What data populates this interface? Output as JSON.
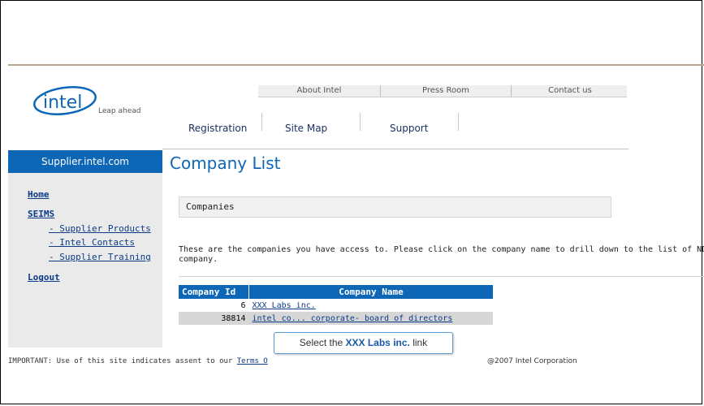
{
  "top_links": [
    "About Intel",
    "Press Room",
    "Contact us"
  ],
  "main_nav": [
    "Registration",
    "Site Map",
    "Support"
  ],
  "logo": {
    "wordmark": "intel",
    "tagline": "Leap ahead"
  },
  "sidebar": {
    "header": "Supplier.intel.com",
    "links": [
      "Home",
      "SEIMS",
      "- Supplier Products",
      "- Intel Contacts",
      "- Supplier Training",
      "Logout"
    ]
  },
  "content": {
    "title": "Company List",
    "section_label": "Companies",
    "intro_line1": "These are the companies you have access to. Please click on the company name to drill down to the list of NDAs fo",
    "intro_line2": "company.",
    "table": {
      "headers": [
        "Company Id",
        "Company Name"
      ],
      "rows": [
        {
          "id": "6",
          "name": "XXX Labs inc."
        },
        {
          "id": "38814",
          "name": "intel co... corporate- board of directors"
        }
      ]
    }
  },
  "tooltip": {
    "prefix": "Select the ",
    "highlight": "XXX Labs inc.",
    "suffix": " link"
  },
  "footer": {
    "important_prefix": "IMPORTANT: Use of this site indicates assent to our ",
    "terms_link": "Terms O",
    "copyright": "@2007 Intel Corporation"
  },
  "colors": {
    "brand_blue": "#0d66b6",
    "link_navy": "#0b3a88",
    "tooltip_border": "#5b9bd5"
  }
}
